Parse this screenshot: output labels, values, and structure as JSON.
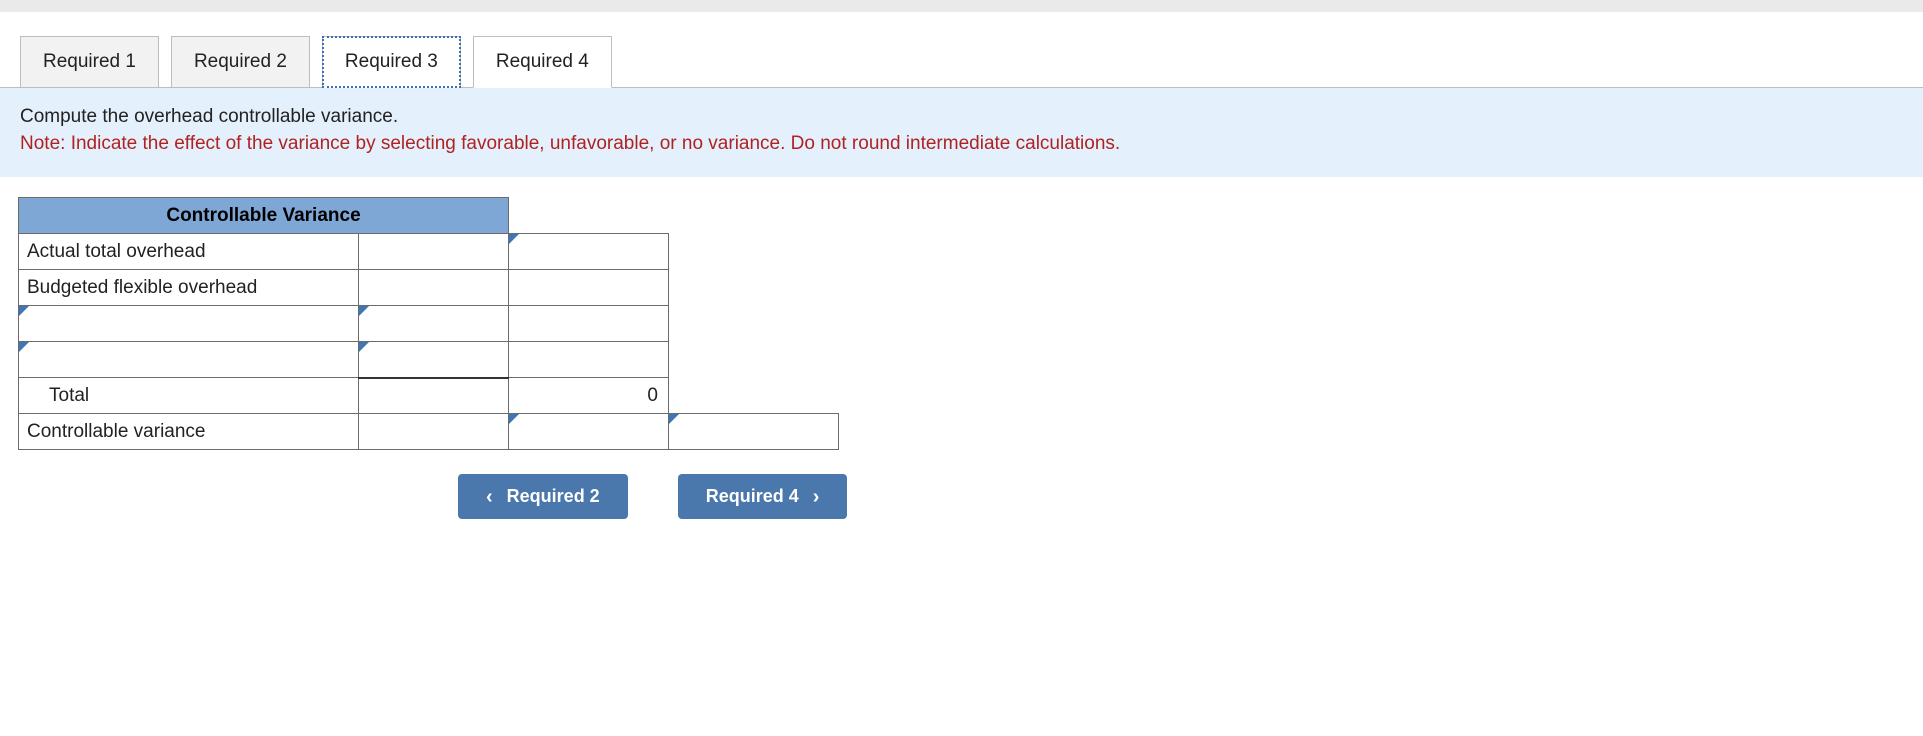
{
  "tabs": [
    {
      "label": "Required 1"
    },
    {
      "label": "Required 2"
    },
    {
      "label": "Required 3"
    },
    {
      "label": "Required 4"
    }
  ],
  "active_tab_index": 2,
  "instruction": {
    "main": "Compute the overhead controllable variance.",
    "note": "Note: Indicate the effect of the variance by selecting favorable, unfavorable, or no variance. Do not round intermediate calculations."
  },
  "sheet": {
    "header": "Controllable Variance",
    "rows": {
      "r1_label": "Actual total overhead",
      "r2_label": "Budgeted flexible overhead",
      "r3_label": "",
      "r4_label": "",
      "r5_label": "Total",
      "r5_valC": "0",
      "r6_label": "Controllable variance"
    }
  },
  "nav": {
    "prev_label": "Required 2",
    "next_label": "Required 4"
  }
}
